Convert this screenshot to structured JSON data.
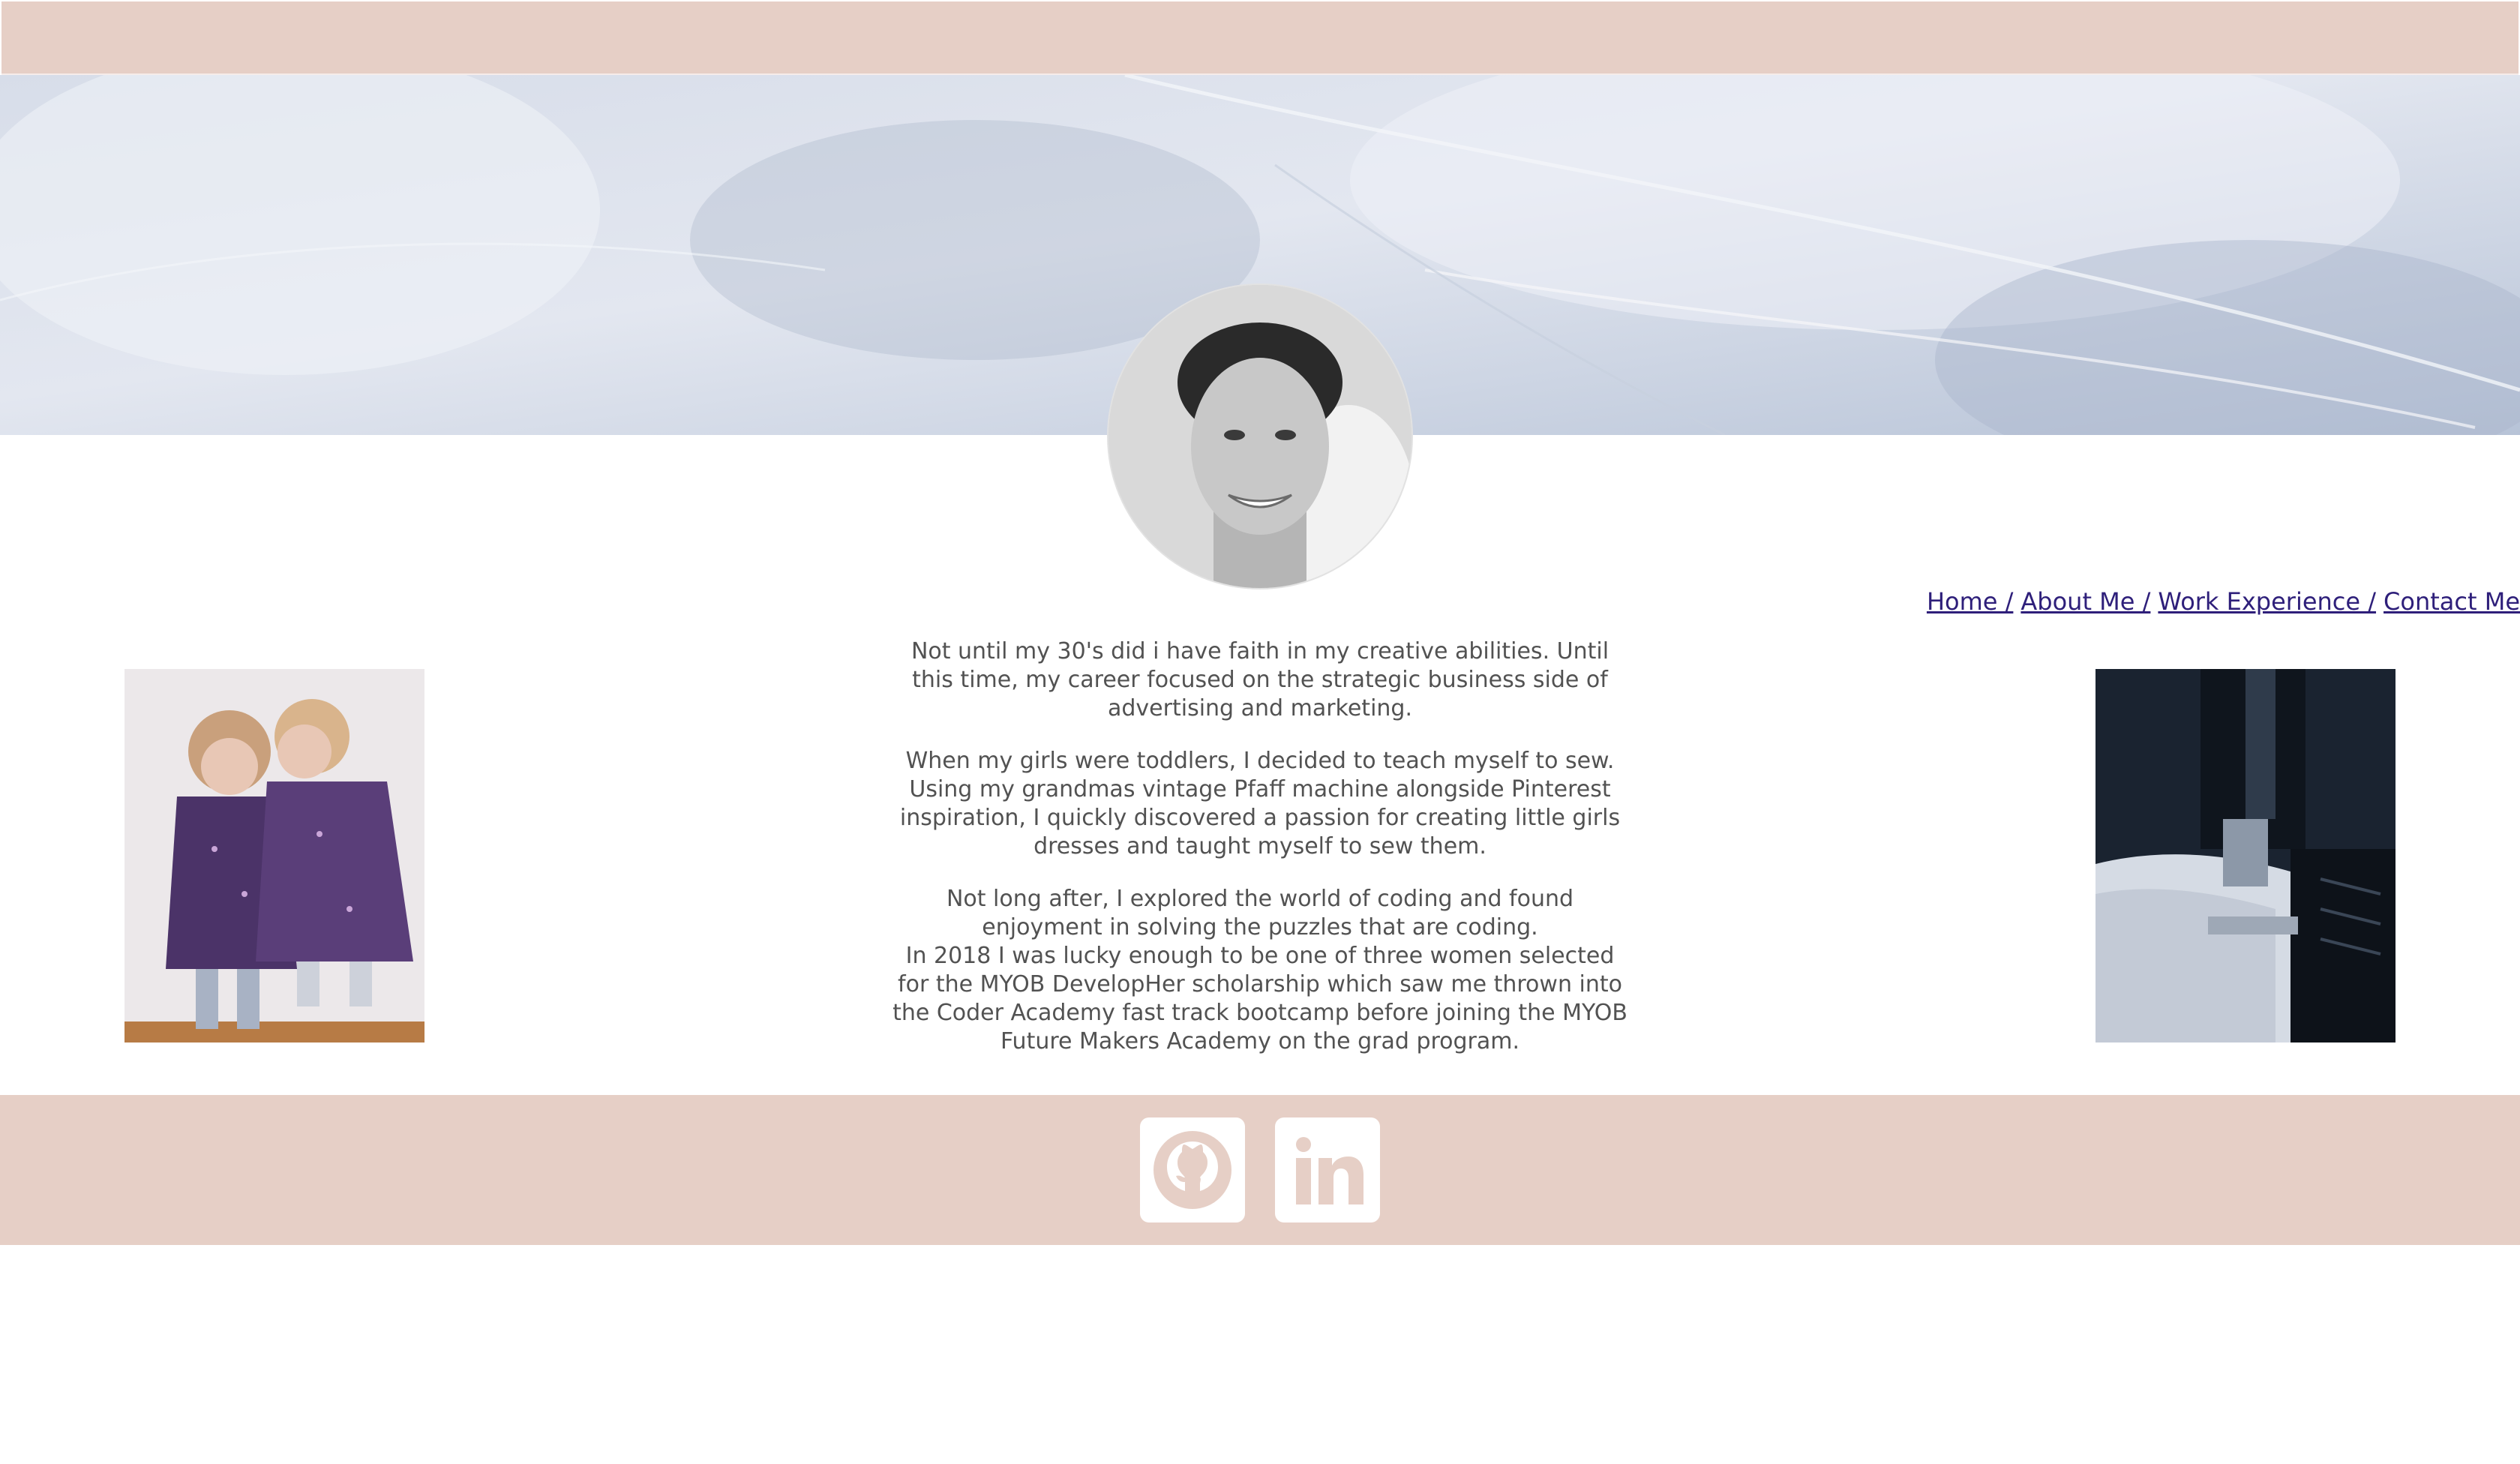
{
  "header": {
    "background_color": "#e6cfc6"
  },
  "hero": {
    "image": "feather-banner"
  },
  "profile": {
    "avatar": "portrait-photo"
  },
  "nav": {
    "items": [
      {
        "label": "Home /"
      },
      {
        "label": "About Me /"
      },
      {
        "label": "Work Experience /"
      },
      {
        "label": "Contact Me"
      }
    ],
    "link_color": "#2e1f7a"
  },
  "images": {
    "left": "girls-in-dresses-photo",
    "right": "sewing-machine-photo"
  },
  "bio": {
    "paragraphs": [
      "Not until my 30's did i have faith in my creative abilities. Until this time, my career focused on the strategic business side of advertising and marketing.",
      "When my girls were toddlers, I decided to teach myself to sew. Using my grandmas vintage Pfaff machine alongside Pinterest inspiration, I quickly discovered a passion for creating little girls dresses and taught myself to sew them.",
      "Not long after, I explored the world of coding and found enjoyment in solving the puzzles that are coding.",
      "In 2018 I was lucky enough to be one of three women selected for the MYOB DevelopHer scholarship which saw me thrown into the Coder Academy fast track bootcamp before joining the MYOB Future Makers Academy on the grad program."
    ],
    "text_color": "#525252"
  },
  "footer": {
    "background_color": "#e6cfc6",
    "social": [
      {
        "icon": "github-icon"
      },
      {
        "icon": "linkedin-icon"
      }
    ]
  }
}
